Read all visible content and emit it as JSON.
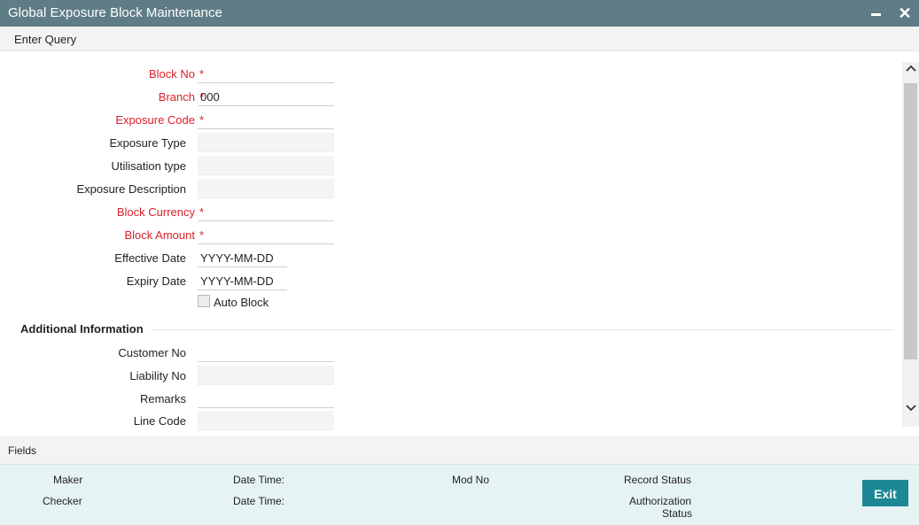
{
  "window": {
    "title": "Global Exposure Block Maintenance"
  },
  "toolbar": {
    "enter_query": "Enter Query"
  },
  "form": {
    "block_no": {
      "label": "Block No",
      "value": ""
    },
    "branch": {
      "label": "Branch",
      "value": "000"
    },
    "exposure_code": {
      "label": "Exposure Code",
      "value": ""
    },
    "exposure_type": {
      "label": "Exposure Type",
      "value": ""
    },
    "utilisation_type": {
      "label": "Utilisation type",
      "value": ""
    },
    "exposure_description": {
      "label": "Exposure Description",
      "value": ""
    },
    "block_currency": {
      "label": "Block Currency",
      "value": ""
    },
    "block_amount": {
      "label": "Block Amount",
      "value": ""
    },
    "effective_date": {
      "label": "Effective Date",
      "placeholder": "YYYY-MM-DD"
    },
    "expiry_date": {
      "label": "Expiry Date",
      "placeholder": "YYYY-MM-DD"
    },
    "auto_block": {
      "label": "Auto Block",
      "checked": false
    },
    "required_marker": "*"
  },
  "additional": {
    "heading": "Additional Information",
    "customer_no": {
      "label": "Customer No",
      "value": ""
    },
    "liability_no": {
      "label": "Liability No",
      "value": ""
    },
    "remarks": {
      "label": "Remarks",
      "value": ""
    },
    "line_code": {
      "label": "Line Code",
      "value": ""
    }
  },
  "fields_bar": {
    "label": "Fields"
  },
  "footer": {
    "maker": "Maker",
    "checker": "Checker",
    "date_time_1": "Date Time:",
    "date_time_2": "Date Time:",
    "mod_no": "Mod No",
    "record_status": "Record Status",
    "authorization_status_1": "Authorization",
    "authorization_status_2": "Status",
    "exit": "Exit"
  },
  "colors": {
    "titlebar": "#5f7d86",
    "required": "#d9202a",
    "exit_button": "#1d8795",
    "footer_bg": "#e6f3f3"
  }
}
